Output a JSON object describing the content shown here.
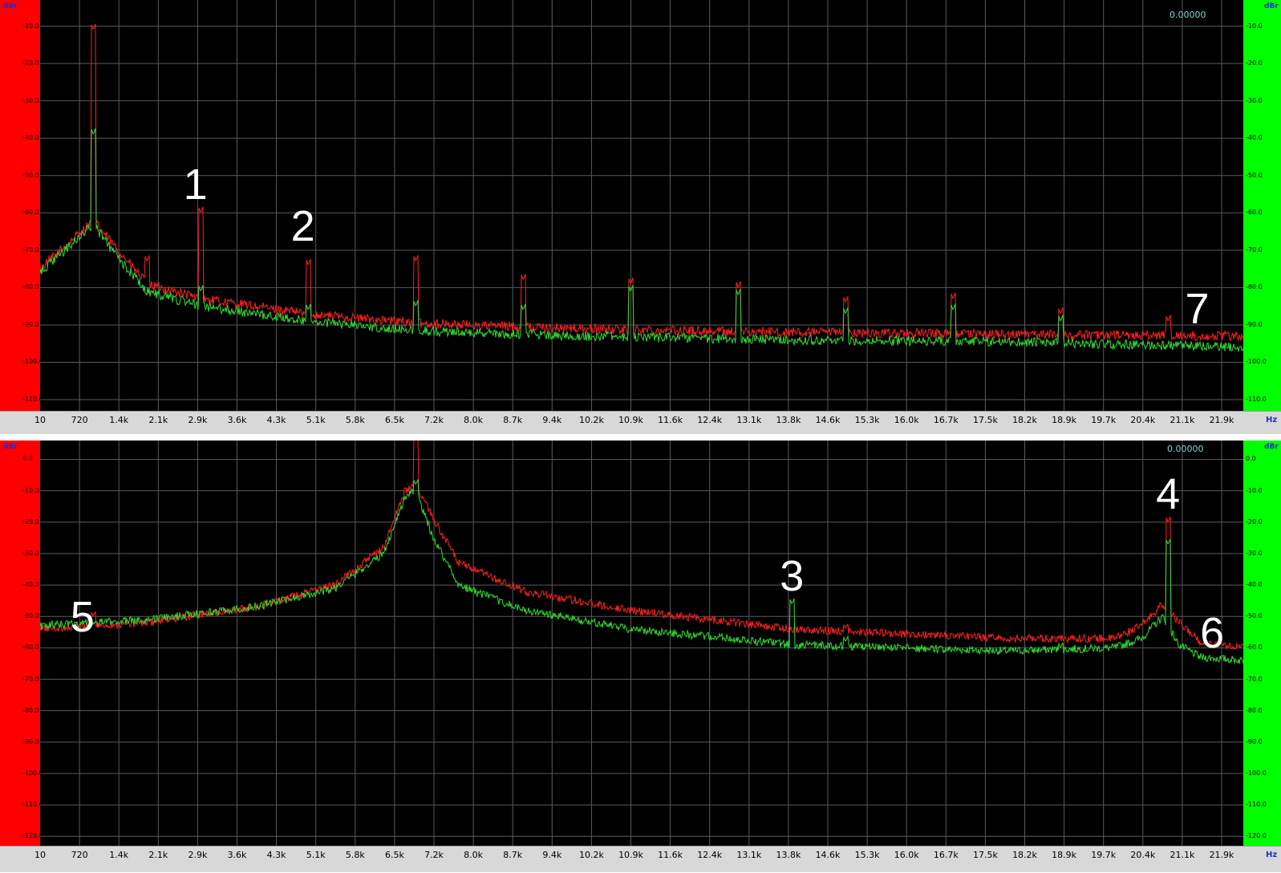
{
  "chart_data": [
    {
      "type": "line",
      "x_unit": "Hz",
      "y_unit_left": "dBr",
      "y_unit_right": "dBr",
      "readout": "0.00000",
      "x_tick_labels": [
        "10",
        "720",
        "1.4k",
        "2.1k",
        "2.9k",
        "3.6k",
        "4.3k",
        "5.1k",
        "5.8k",
        "6.5k",
        "7.2k",
        "8.0k",
        "8.7k",
        "9.4k",
        "10.2k",
        "10.9k",
        "11.6k",
        "12.4k",
        "13.1k",
        "13.8k",
        "14.6k",
        "15.3k",
        "16.0k",
        "16.7k",
        "17.5k",
        "18.2k",
        "18.9k",
        "19.7k",
        "20.4k",
        "21.1k",
        "21.9k"
      ],
      "y_tick_labels": [
        "-10.0",
        "-20.0",
        "-30.0",
        "-40.0",
        "-50.0",
        "-60.0",
        "-70.0",
        "-80.0",
        "-90.0",
        "-100.0",
        "-110.0"
      ],
      "ylim": [
        -113,
        -3
      ],
      "xlim": [
        10,
        22400
      ],
      "series": [
        {
          "color": "#ff2020",
          "noise_floor": [
            [
              10,
              -75
            ],
            [
              700,
              -66
            ],
            [
              1000,
              -62
            ],
            [
              1400,
              -69
            ],
            [
              2000,
              -79
            ],
            [
              3000,
              -83
            ],
            [
              5000,
              -87
            ],
            [
              7000,
              -89.5
            ],
            [
              10000,
              -91
            ],
            [
              14000,
              -92
            ],
            [
              18000,
              -92.5
            ],
            [
              22400,
              -93
            ]
          ],
          "peaks": [
            [
              1000,
              -11
            ],
            [
              2000,
              -73
            ],
            [
              3000,
              -60
            ],
            [
              5000,
              -74
            ],
            [
              7000,
              -73
            ],
            [
              9000,
              -78
            ],
            [
              11000,
              -79
            ],
            [
              13000,
              -80
            ],
            [
              15000,
              -84
            ],
            [
              17000,
              -83
            ],
            [
              19000,
              -87
            ],
            [
              21000,
              -89
            ]
          ]
        },
        {
          "color": "#30dd30",
          "noise_floor": [
            [
              10,
              -76
            ],
            [
              700,
              -67
            ],
            [
              1000,
              -63
            ],
            [
              1400,
              -71
            ],
            [
              2000,
              -81
            ],
            [
              3000,
              -85
            ],
            [
              5000,
              -89
            ],
            [
              7000,
              -91.5
            ],
            [
              10000,
              -93
            ],
            [
              14000,
              -94
            ],
            [
              18000,
              -94.5
            ],
            [
              22400,
              -96
            ]
          ],
          "peaks": [
            [
              1000,
              -39
            ],
            [
              3000,
              -81
            ],
            [
              5000,
              -86
            ],
            [
              7000,
              -85
            ],
            [
              9000,
              -86
            ],
            [
              11000,
              -81
            ],
            [
              13000,
              -82
            ],
            [
              15000,
              -87
            ],
            [
              17000,
              -86
            ],
            [
              19000,
              -89
            ]
          ]
        }
      ],
      "annotations": [
        {
          "label": "1",
          "x": 2900,
          "y": -60
        },
        {
          "label": "2",
          "x": 4900,
          "y": -71
        },
        {
          "label": "7",
          "x": 21900,
          "y": -89
        }
      ]
    },
    {
      "type": "line",
      "x_unit": "Hz",
      "y_unit_left": "dBr",
      "y_unit_right": "dBr",
      "readout": "0.00000",
      "x_tick_labels": [
        "10",
        "720",
        "1.4k",
        "2.1k",
        "2.9k",
        "3.6k",
        "4.3k",
        "5.1k",
        "5.8k",
        "6.5k",
        "7.2k",
        "8.0k",
        "8.7k",
        "9.4k",
        "10.2k",
        "10.9k",
        "11.6k",
        "12.4k",
        "13.1k",
        "13.8k",
        "14.6k",
        "15.3k",
        "16.0k",
        "16.7k",
        "17.5k",
        "18.2k",
        "18.9k",
        "19.7k",
        "20.4k",
        "21.1k",
        "21.9k"
      ],
      "y_tick_labels": [
        "0.0",
        "-10.0",
        "-20.0",
        "-30.0",
        "-40.0",
        "-50.0",
        "-60.0",
        "-70.0",
        "-80.0",
        "-90.0",
        "-100.0",
        "-110.0",
        "-120.0"
      ],
      "ylim": [
        -123,
        6
      ],
      "xlim": [
        10,
        22400
      ],
      "series": [
        {
          "color": "#ff2020",
          "noise_floor": [
            [
              10,
              -54
            ],
            [
              2000,
              -52
            ],
            [
              4000,
              -47
            ],
            [
              5500,
              -40
            ],
            [
              6400,
              -28
            ],
            [
              6800,
              -10
            ],
            [
              7000,
              -8
            ],
            [
              7300,
              -18
            ],
            [
              7800,
              -33
            ],
            [
              9000,
              -42
            ],
            [
              11000,
              -48
            ],
            [
              14000,
              -54
            ],
            [
              18000,
              -57
            ],
            [
              20000,
              -57
            ],
            [
              20500,
              -53
            ],
            [
              20900,
              -46
            ],
            [
              21200,
              -52
            ],
            [
              21600,
              -58
            ],
            [
              22400,
              -60
            ]
          ],
          "peaks": [
            [
              7000,
              6
            ],
            [
              1000,
              -50
            ],
            [
              2900,
              -50
            ],
            [
              5000,
              -43
            ],
            [
              15000,
              -54
            ],
            [
              21000,
              -20
            ]
          ]
        },
        {
          "color": "#30dd30",
          "noise_floor": [
            [
              10,
              -53
            ],
            [
              2000,
              -51
            ],
            [
              4000,
              -47
            ],
            [
              5500,
              -41
            ],
            [
              6400,
              -30
            ],
            [
              6800,
              -12
            ],
            [
              7000,
              -10
            ],
            [
              7300,
              -24
            ],
            [
              7800,
              -40
            ],
            [
              9000,
              -48
            ],
            [
              11000,
              -54
            ],
            [
              14000,
              -59
            ],
            [
              18000,
              -61
            ],
            [
              20000,
              -60
            ],
            [
              20500,
              -57
            ],
            [
              20900,
              -50
            ],
            [
              21200,
              -59
            ],
            [
              21600,
              -63
            ],
            [
              22400,
              -64
            ]
          ],
          "peaks": [
            [
              7000,
              -8
            ],
            [
              14000,
              -46
            ],
            [
              15000,
              -58
            ],
            [
              19000,
              -60
            ],
            [
              21000,
              -27
            ]
          ]
        }
      ],
      "annotations": [
        {
          "label": "3",
          "x": 14000,
          "y": -46
        },
        {
          "label": "4",
          "x": 21000,
          "y": -20
        },
        {
          "label": "5",
          "x": 500,
          "y": -54
        },
        {
          "label": "6",
          "x": 22000,
          "y": -58
        }
      ]
    }
  ]
}
